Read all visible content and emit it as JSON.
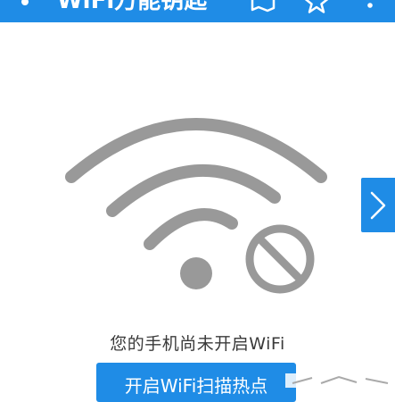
{
  "app_bar": {
    "title": "WiFi万能钥匙",
    "icons": [
      "wifi-logo-icon",
      "map-icon",
      "star-icon",
      "more-icon"
    ],
    "color": "#1f8ce6"
  },
  "status": {
    "message": "您的手机尚未开启WiFi",
    "illustration": "wifi-disabled-icon",
    "icon_color": "#999999"
  },
  "actions": {
    "enable_button_label": "开启WiFi扫描热点",
    "side_arrow": "chevron-right-icon"
  }
}
